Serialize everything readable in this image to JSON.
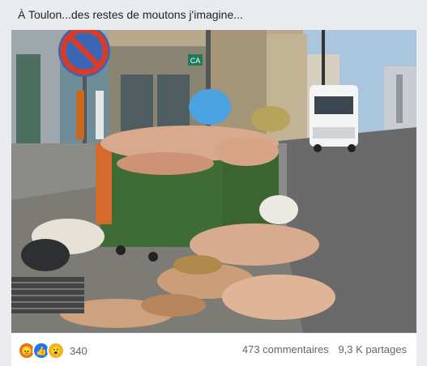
{
  "post": {
    "text": "À Toulon...des restes de moutons j'imagine..."
  },
  "photo": {
    "store_logo_text": "CA"
  },
  "footer": {
    "reactions": [
      {
        "icon": "angry-reaction-icon",
        "color": "#e9710f"
      },
      {
        "icon": "like-reaction-icon",
        "color": "#1877f2"
      },
      {
        "icon": "wow-reaction-icon",
        "color": "#f7b125"
      }
    ],
    "reaction_count": "340",
    "comments": "473 commentaires",
    "shares": "9,3 K partages"
  }
}
